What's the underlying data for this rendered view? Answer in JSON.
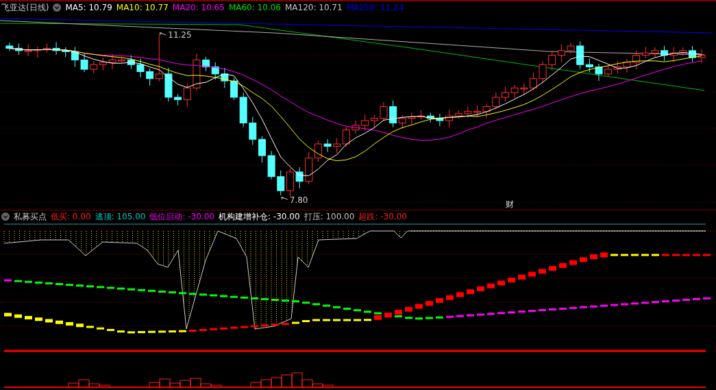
{
  "main_chart": {
    "title": "飞亚达(日线)",
    "indicators": [
      {
        "label": "MA5: 10.79",
        "color": "#ffffff"
      },
      {
        "label": "MA10: 10.77",
        "color": "#ffff00"
      },
      {
        "label": "MA20: 10.65",
        "color": "#ff00ff"
      },
      {
        "label": "MA60: 10.06",
        "color": "#00e000"
      },
      {
        "label": "MA120: 10.71",
        "color": "#c8c8c8"
      },
      {
        "label": "MA250: 11.24",
        "color": "#0000ff"
      }
    ],
    "high_label": "11.25",
    "low_label": "7.80",
    "marker": "财"
  },
  "sub_chart": {
    "title": "私募买点",
    "indicators": [
      {
        "label": "低买: 0.00",
        "color": "#ff2020"
      },
      {
        "label": "逃顶: 105.00",
        "color": "#00c8c8"
      },
      {
        "label": "低位启动: -30.00",
        "color": "#ff00ff"
      },
      {
        "label": "机构建增补仓: -30.00",
        "color": "#ffffff"
      },
      {
        "label": "打压: 100.00",
        "color": "#c0c0c0"
      },
      {
        "label": "超跌: -30.00",
        "color": "#ff2020"
      }
    ]
  }
}
